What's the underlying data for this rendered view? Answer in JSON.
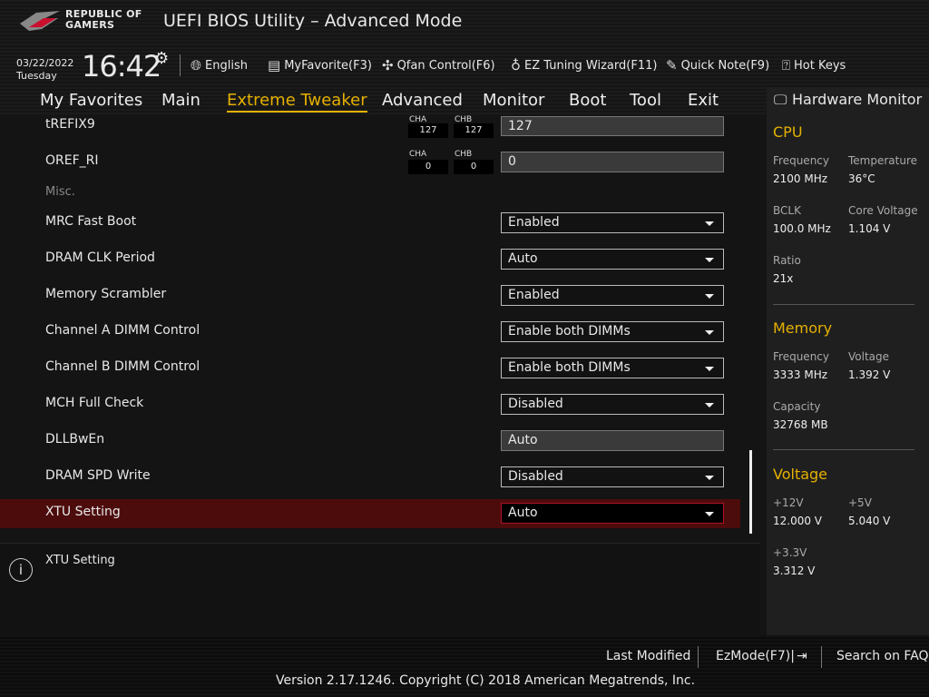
{
  "header": {
    "logo_text": "REPUBLIC OF GAMERS",
    "title": "UEFI BIOS Utility – Advanced Mode",
    "date": "03/22/2022",
    "day": "Tuesday",
    "time": "16:42"
  },
  "toolbar": [
    {
      "label": "English",
      "icon": "globe-icon"
    },
    {
      "label": "MyFavorite(F3)",
      "icon": "favorite-icon"
    },
    {
      "label": "Qfan Control(F6)",
      "icon": "fan-icon"
    },
    {
      "label": "EZ Tuning Wizard(F11)",
      "icon": "bulb-icon"
    },
    {
      "label": "Quick Note(F9)",
      "icon": "note-icon"
    },
    {
      "label": "Hot Keys",
      "icon": "help-icon"
    }
  ],
  "tabs": [
    "My Favorites",
    "Main",
    "Extreme Tweaker",
    "Advanced",
    "Monitor",
    "Boot",
    "Tool",
    "Exit"
  ],
  "active_tab": "Extreme Tweaker",
  "settings": {
    "trefix9": {
      "label": "tREFIX9",
      "cha_label": "CHA",
      "chb_label": "CHB",
      "cha": "127",
      "chb": "127",
      "value": "127"
    },
    "oref_ri": {
      "label": "OREF_RI",
      "cha_label": "CHA",
      "chb_label": "CHB",
      "cha": "0",
      "chb": "0",
      "value": "0"
    },
    "misc": "Misc.",
    "rows": [
      {
        "label": "MRC Fast Boot",
        "value": "Enabled",
        "type": "select"
      },
      {
        "label": "DRAM CLK Period",
        "value": "Auto",
        "type": "select"
      },
      {
        "label": "Memory Scrambler",
        "value": "Enabled",
        "type": "select"
      },
      {
        "label": "Channel A DIMM Control",
        "value": "Enable both DIMMs",
        "type": "select"
      },
      {
        "label": "Channel B DIMM Control",
        "value": "Enable both DIMMs",
        "type": "select"
      },
      {
        "label": "MCH Full Check",
        "value": "Disabled",
        "type": "select"
      },
      {
        "label": "DLLBwEn",
        "value": "Auto",
        "type": "input"
      },
      {
        "label": "DRAM SPD Write",
        "value": "Disabled",
        "type": "select"
      },
      {
        "label": "XTU Setting",
        "value": "Auto",
        "type": "select"
      }
    ]
  },
  "help": {
    "text": "XTU Setting"
  },
  "hw": {
    "title": "Hardware Monitor",
    "cpu": {
      "title": "CPU",
      "frequency_label": "Frequency",
      "frequency": "2100 MHz",
      "temp_label": "Temperature",
      "temp": "36°C",
      "bclk_label": "BCLK",
      "bclk": "100.0 MHz",
      "vcore_label": "Core Voltage",
      "vcore": "1.104 V",
      "ratio_label": "Ratio",
      "ratio": "21x"
    },
    "memory": {
      "title": "Memory",
      "frequency_label": "Frequency",
      "frequency": "3333 MHz",
      "voltage_label": "Voltage",
      "voltage": "1.392 V",
      "capacity_label": "Capacity",
      "capacity": "32768 MB"
    },
    "voltage": {
      "title": "Voltage",
      "v12_label": "+12V",
      "v12": "12.000 V",
      "v5_label": "+5V",
      "v5": "5.040 V",
      "v33_label": "+3.3V",
      "v33": "3.312 V"
    }
  },
  "footer": {
    "last_modified": "Last Modified",
    "ezmode": "EzMode(F7)|",
    "search": "Search on FAQ",
    "version": "Version 2.17.1246. Copyright (C) 2018 American Megatrends, Inc."
  },
  "colors": {
    "accent": "#e5b100",
    "selected_row": "#4d0c0c"
  }
}
